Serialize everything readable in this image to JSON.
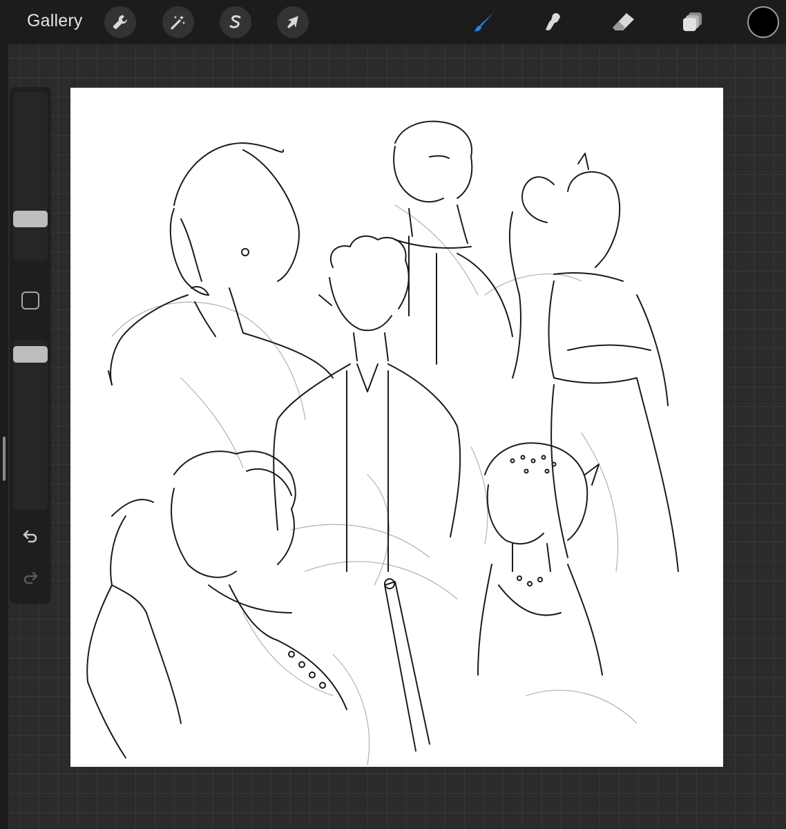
{
  "toolbar": {
    "gallery_label": "Gallery",
    "left_tools": [
      {
        "name": "wrench-icon",
        "role": "actions"
      },
      {
        "name": "magic-wand-icon",
        "role": "adjustments"
      },
      {
        "name": "selection-s-icon",
        "role": "selection"
      },
      {
        "name": "transform-arrow-icon",
        "role": "transform"
      }
    ],
    "right_tools": [
      {
        "name": "brush-icon",
        "role": "paint",
        "active": true
      },
      {
        "name": "smudge-icon",
        "role": "smudge"
      },
      {
        "name": "eraser-icon",
        "role": "erase"
      },
      {
        "name": "layers-icon",
        "role": "layers"
      }
    ],
    "current_color": "#000000"
  },
  "sidebar": {
    "brush_size_level": 0.22,
    "opacity_level": 0.96,
    "icons": [
      "modifier-square-icon",
      "undo-icon",
      "redo-icon"
    ]
  },
  "colors": {
    "ui_bar": "#1c1c1c",
    "canvas_bg": "#2b2b2b",
    "active_tool": "#2f7de1",
    "icon": "#d9d9d9",
    "sketch_line": "#1a1a1a",
    "sketch_pencil": "#a8a8a8"
  }
}
